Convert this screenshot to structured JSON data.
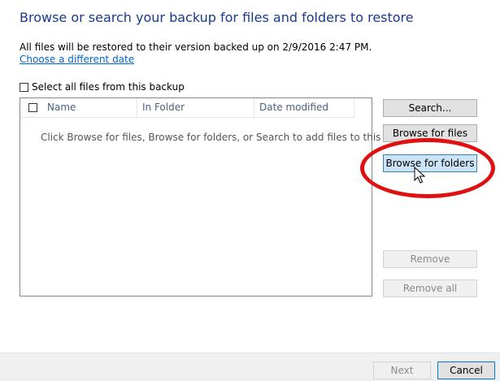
{
  "header": {
    "title": "Browse or search your backup for files and folders to restore",
    "restore_info": "All files will be restored to their version backed up on 2/9/2016 2:47 PM.",
    "change_date_link": "Choose a different date"
  },
  "select_all": {
    "label": "Select all files from this backup",
    "checked": false
  },
  "file_list": {
    "columns": [
      "Name",
      "In Folder",
      "Date modified"
    ],
    "empty_message": "Click Browse for files, Browse for folders, or Search to add files to this list.",
    "rows": []
  },
  "side_buttons": {
    "search": "Search...",
    "browse_files": "Browse for files",
    "browse_folders": "Browse for folders",
    "remove": "Remove",
    "remove_all": "Remove all"
  },
  "footer": {
    "next": "Next",
    "cancel": "Cancel"
  },
  "colors": {
    "title": "#1a3a8f",
    "link": "#0066cc",
    "highlight_ring": "#e01010",
    "hover_button": "#cce4f7"
  }
}
